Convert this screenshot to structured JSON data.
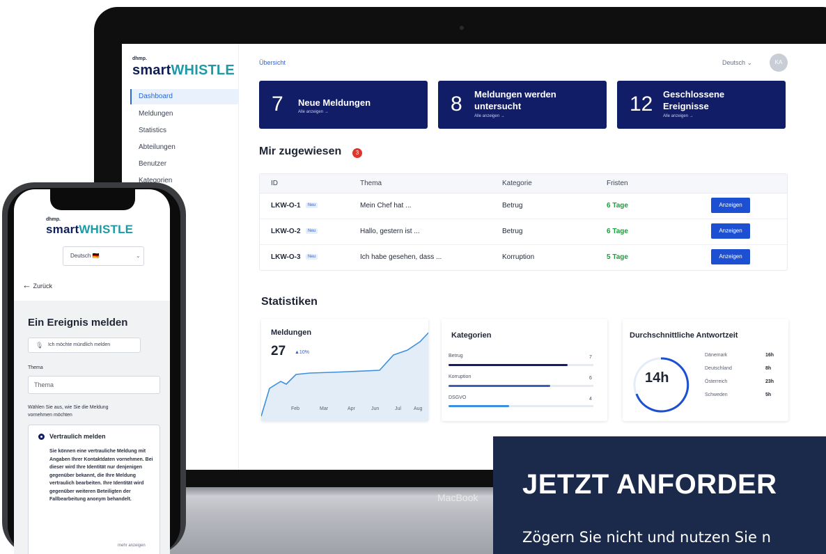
{
  "brand": {
    "prefix": "dhmp.",
    "name_part1": "smart",
    "name_part2": "WHISTLE"
  },
  "dashboard": {
    "breadcrumb": "Übersicht",
    "language": "Deutsch",
    "avatar_initials": "KA",
    "sidebar": {
      "items": [
        {
          "label": "Dashboard",
          "active": true
        },
        {
          "label": "Meldungen"
        },
        {
          "label": "Statistics"
        },
        {
          "label": "Abteilungen"
        },
        {
          "label": "Benutzer"
        },
        {
          "label": "Kategorien"
        }
      ]
    },
    "cards": [
      {
        "number": "7",
        "title": "Neue Meldungen",
        "link": "Alle anzeigen →"
      },
      {
        "number": "8",
        "title_line1": "Meldungen werden",
        "title_line2": "untersucht",
        "link": "Alle anzeigen →"
      },
      {
        "number": "12",
        "title_line1": "Geschlossene",
        "title_line2": "Ereignisse",
        "link": "Alle anzeigen →"
      }
    ],
    "assigned": {
      "heading": "Mir zugewiesen",
      "badge": "3",
      "columns": [
        "ID",
        "Thema",
        "Kategorie",
        "Fristen"
      ],
      "rows": [
        {
          "id": "LKW-O-1",
          "tag": "Neu",
          "topic": "Mein Chef hat ...",
          "category": "Betrug",
          "deadline": "6 Tage",
          "action": "Anzeigen"
        },
        {
          "id": "LKW-O-2",
          "tag": "Neu",
          "topic": "Hallo, gestern ist ...",
          "category": "Betrug",
          "deadline": "6 Tage",
          "action": "Anzeigen"
        },
        {
          "id": "LKW-O-3",
          "tag": "Neu",
          "topic": "Ich habe gesehen, dass ...",
          "category": "Korruption",
          "deadline": "5 Tage",
          "action": "Anzeigen"
        }
      ]
    },
    "stats": {
      "heading": "Statistiken",
      "reports": {
        "title": "Meldungen",
        "value": "27",
        "trend": "▲10%",
        "months": [
          "Feb",
          "Mar",
          "Apr",
          "Jun",
          "Jul",
          "Aug"
        ]
      },
      "categories": {
        "title": "Kategorien",
        "items": [
          {
            "label": "Betrug",
            "value": "7",
            "fraction": 0.82,
            "color": "#111d66"
          },
          {
            "label": "Korruption",
            "value": "6",
            "fraction": 0.7,
            "color": "#3a5fb5"
          },
          {
            "label": "DSGVO",
            "value": "4",
            "fraction": 0.42,
            "color": "#3b8fe0"
          }
        ]
      },
      "response": {
        "title": "Durchschnittliche Antwortzeit",
        "value": "14h",
        "countries": [
          {
            "name": "Dänemark",
            "hours": "16h"
          },
          {
            "name": "Deutschland",
            "hours": "8h"
          },
          {
            "name": "Österreich",
            "hours": "23h"
          },
          {
            "name": "Schweden",
            "hours": "5h"
          }
        ]
      }
    }
  },
  "laptop": {
    "label": "MacBook"
  },
  "phone": {
    "language": "Deutsch 🇩🇪",
    "back": "Zurück",
    "heading": "Ein Ereignis melden",
    "oral_button": "Ich möchte mündlich melden",
    "topic_label": "Thema",
    "topic_placeholder": "Thema",
    "choose_label_line1": "Wählen Sie aus, wie Sie die Meldung",
    "choose_label_line2": "vornehmen möchten",
    "option_title": "Vertraulich melden",
    "option_text": "Sie können eine vertrauliche Meldung mit Angaben Ihrer Kontaktdaten vornehmen. Bei dieser wird Ihre Identität nur denjenigen gegenüber bekannt, die Ihre Meldung vertraulich bearbeiten. Ihre Identität wird gegenüber weiteren Beteiligten der Fallbearbeitung anonym behandelt.",
    "more": "mehr anzeigen"
  },
  "cta": {
    "title": "JETZT ANFORDER",
    "subtitle": "Zögern Sie nicht und nutzen Sie n"
  }
}
